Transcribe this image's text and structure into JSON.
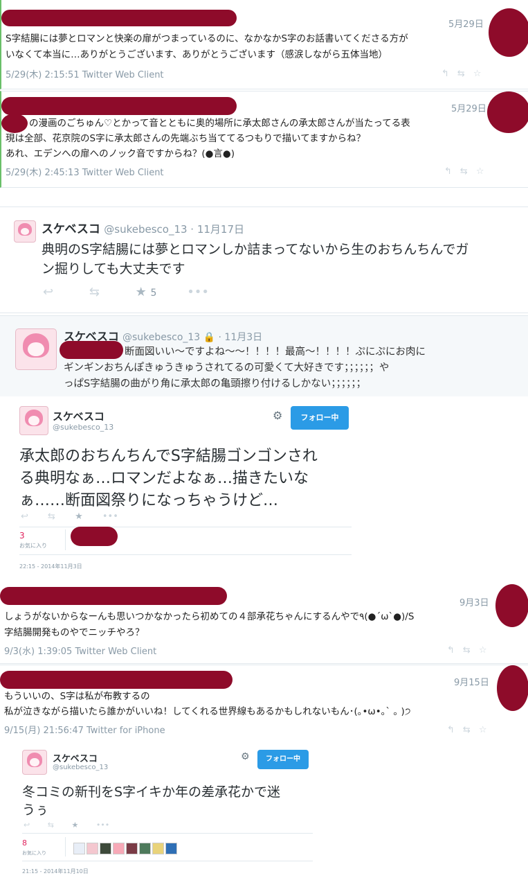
{
  "tweet1": {
    "date": "5月29日",
    "text_line1": "S字結腸には夢とロマンと快楽の扉がつまっているのに、なかなかS字のお話書いてくださる方が",
    "text_line2": "いなくて本当に…ありがとうございます、ありがとうございます（感涙しながら五体当地）",
    "meta": "5/29(木) 2:15:51 Twitter Web Client"
  },
  "tweet2": {
    "date": "5月29日",
    "text_line1": "の漫画のごちゅん♡とかって音とともに奥的場所に承太郎さんの承太郎さんが当たってる表",
    "text_line2": "現は全部、花京院のS字に承太郎さんの先端ぶち当ててるつもりで描いてますからね？",
    "text_line3": "あれ、エデンへの扉へのノック音ですからね？(●言●)",
    "meta": "5/29(木) 2:45:13 Twitter Web Client"
  },
  "tweet3": {
    "name": "スケベスコ",
    "handle": "@sukebesco_13 · 11月17日",
    "text_line1": "典明のS字結腸には夢とロマンしか詰まってないから生のおちんちんでガ",
    "text_line2": "ン掘りしても大丈夫です",
    "fav_count": "5"
  },
  "tweet4": {
    "name": "スケベスコ",
    "handle": "@sukebesco_13 🔒 · 11月3日",
    "text_line1": "断面図いい～ですよね～～！！！！最高～！！！！ぷにぷにお肉に",
    "text_line2": "ギンギンおちんぽきゅうきゅうされてるの可愛くて大好きです；；；；；；や",
    "text_line3": "っぱS字結腸の曲がり角に承太郎の亀頭擦り付けるしかない；；；；；；"
  },
  "tweet5": {
    "name": "スケベスコ",
    "handle": "@sukebesco_13",
    "follow_label": "フォロー中",
    "text_line1": "承太郎のおちんちんでS字結腸ゴンゴンされ",
    "text_line2": "る典明なぁ…ロマンだよなぁ…描きたいな",
    "text_line3": "ぁ……断面図祭りになっちゃうけど…",
    "fav_count": "3",
    "fav_label": "お気に入り",
    "timestamp": "22:15 - 2014年11月3日"
  },
  "tweet6": {
    "date": "9月3日",
    "text_line1": "しょうがないからなーんも思いつかなかったら初めての４部承花ちゃんにするんやで٩(●ˊωˋ●)/S",
    "text_line2": "字結腸開発ものやでニッチやろ？",
    "meta": "9/3(水) 1:39:05 Twitter Web Client"
  },
  "tweet7": {
    "date": "9月15日",
    "text_line1": "もういいの、S字は私が布教するの",
    "text_line2": "私が泣きながら描いたら誰かがいいね！してくれる世界線もあるかもしれないもん･(｡•ω•｡` ｡ )੭",
    "meta": "9/15(月) 21:56:47 Twitter for iPhone"
  },
  "tweet8": {
    "name": "スケベスコ",
    "handle": "@sukebesco_13",
    "follow_label": "フォロー中",
    "text_line1": "冬コミの新刊をS字イキか年の差承花かで迷",
    "text_line2": "うぅ",
    "fav_count": "8",
    "fav_label": "お気に入り",
    "timestamp": "21:15 - 2014年11月10日"
  },
  "colors": {
    "redaction": "#8e0b2a",
    "follow_button": "#2b9be6",
    "fav_count": "#e0245e",
    "muted": "#8899a6"
  }
}
